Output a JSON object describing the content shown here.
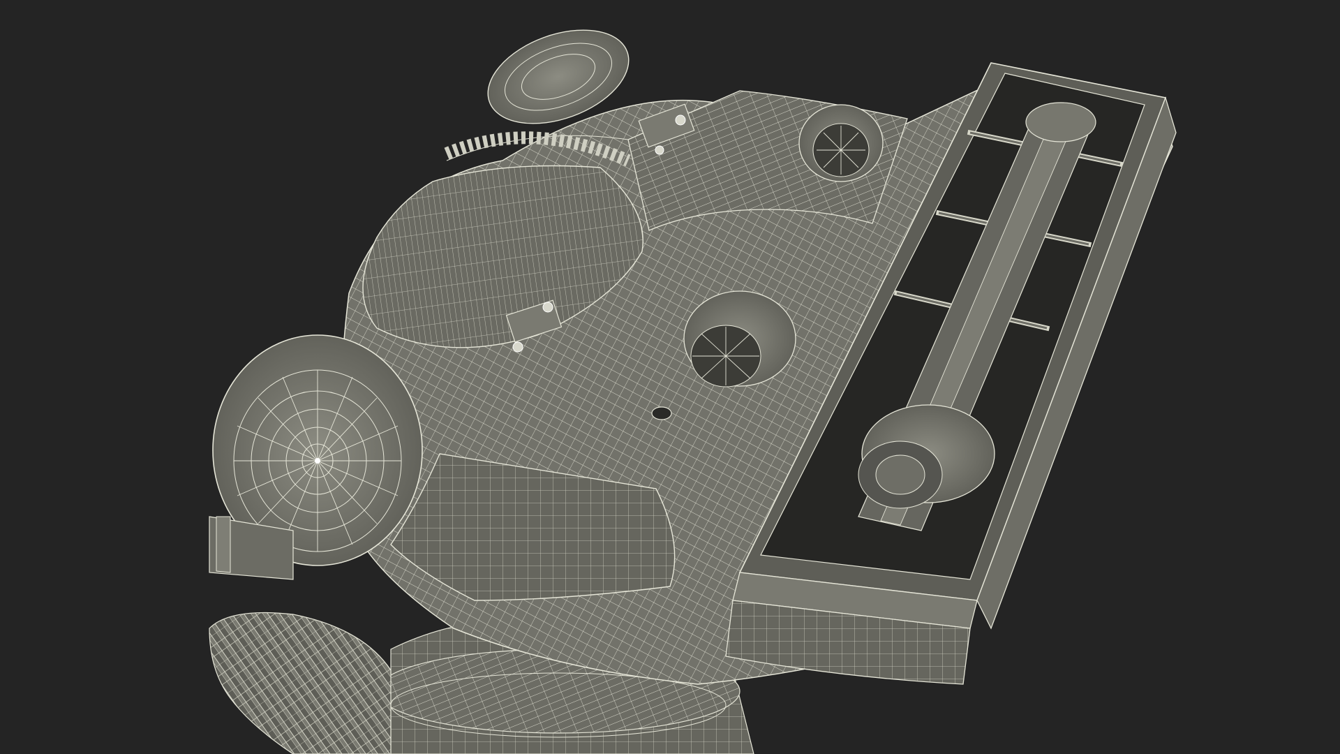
{
  "scene": {
    "subject": "wireframe-render",
    "colors": {
      "background": "#242424",
      "body_fill": "#6f6f66",
      "body_fill_light": "#8a8a80",
      "body_fill_dark": "#4a4a44",
      "cavity": "#1f1f1d",
      "wire": "#e6e6d8"
    }
  }
}
